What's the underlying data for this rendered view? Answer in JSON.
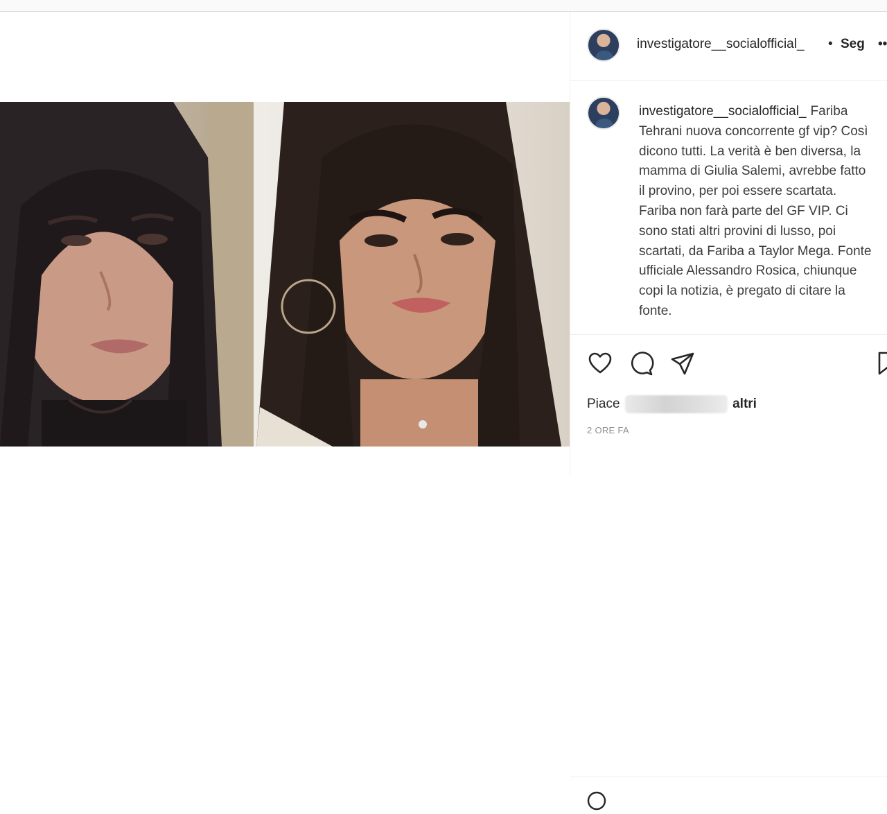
{
  "post": {
    "username": "investigatore__socialofficial_",
    "separator": "•",
    "follow_label": "Segui",
    "more_label": "•••"
  },
  "caption": {
    "username": "investigatore__socialofficial_",
    "text": "Fariba Tehrani nuova concorrente gf vip? Così dicono tutti. La verità è ben diversa, la mamma di Giulia Salemi, avrebbe fatto il provino, per poi essere scartata. Fariba non farà parte del GF VIP. Ci sono stati altri provini di lusso, poi scartati, da Fariba a Taylor Mega. Fonte ufficiale Alessandro Rosica, chiunque copi la notizia, è pregato di citare la fonte."
  },
  "actions": {
    "like_icon": "heart-icon",
    "comment_icon": "comment-icon",
    "share_icon": "paper-plane-icon",
    "save_icon": "bookmark-icon"
  },
  "likes": {
    "prefix": "Piace",
    "suffix": "altri"
  },
  "timestamp": "2 ORE FA",
  "colors": {
    "text": "#262626",
    "muted": "#8e8e8e",
    "border": "#efefef"
  }
}
